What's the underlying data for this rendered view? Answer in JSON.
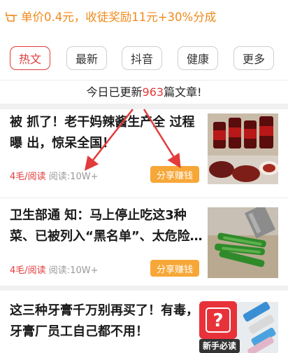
{
  "banner": {
    "icon": "pointing-hand-icon",
    "text": "单价0.4元，收徒奖励11元+30%分成",
    "color": "#f08a1c"
  },
  "tabs": [
    {
      "label": "热文",
      "active": true
    },
    {
      "label": "最新",
      "active": false
    },
    {
      "label": "抖音",
      "active": false
    },
    {
      "label": "健康",
      "active": false
    },
    {
      "label": "更多",
      "active": false
    }
  ],
  "update": {
    "prefix": "今日已更新",
    "count": "963",
    "suffix": "篇文章!"
  },
  "articles": [
    {
      "title": "被 抓了！老干妈辣酱生产全 过程曝 出，惊呆全国！",
      "price": "4毛/阅读",
      "reads": "阅读:10W+",
      "share": "分享赚钱",
      "thumb": "chili-sauce-jars-image"
    },
    {
      "title": "卫生部通 知：马上停止吃这3种菜、已被列入“黑名单”、太危险…",
      "price": "4毛/阅读",
      "reads": "阅读:10W+",
      "share": "分享赚钱",
      "thumb": "chopped-vegetables-image"
    },
    {
      "title": "这三种牙膏千万别再买了！有毒，牙膏厂员工自己都不用！",
      "thumb": "toothpaste-image"
    }
  ],
  "guide": {
    "icon": "question-mark-icon",
    "label": "新手必读"
  },
  "colors": {
    "accent": "#e23b3b",
    "share": "#f7a738",
    "arrow": "#e23b3b"
  }
}
